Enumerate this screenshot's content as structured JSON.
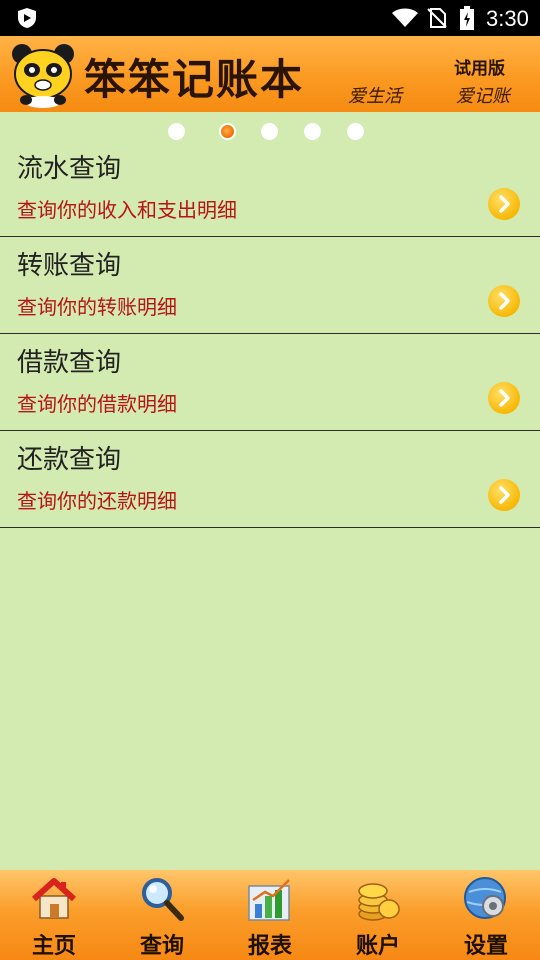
{
  "status_bar": {
    "time": "3:30"
  },
  "banner": {
    "app_title": "笨笨记账本",
    "trial_label": "试用版",
    "slogan_left": "爱生活",
    "slogan_right": "爱记账"
  },
  "pager": {
    "total": 5,
    "active_index": 1
  },
  "query_items": [
    {
      "title": "流水查询",
      "desc": "查询你的收入和支出明细"
    },
    {
      "title": "转账查询",
      "desc": "查询你的转账明细"
    },
    {
      "title": "借款查询",
      "desc": "查询你的借款明细"
    },
    {
      "title": "还款查询",
      "desc": "查询你的还款明细"
    }
  ],
  "bottom_nav": [
    {
      "label": "主页",
      "icon": "home-icon"
    },
    {
      "label": "查询",
      "icon": "magnifier-icon"
    },
    {
      "label": "报表",
      "icon": "bar-chart-icon"
    },
    {
      "label": "账户",
      "icon": "coins-icon"
    },
    {
      "label": "设置",
      "icon": "gear-globe-icon"
    }
  ],
  "colors": {
    "background": "#d3eab0",
    "banner_orange": "#fb9a22",
    "desc_red": "#b81414",
    "arrow_yellow": "#f7b500"
  }
}
